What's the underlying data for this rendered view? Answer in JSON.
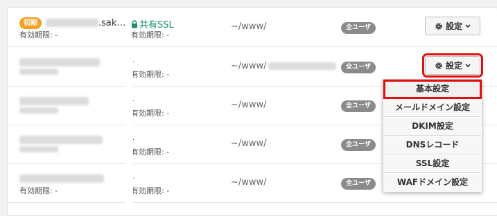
{
  "rows": [
    {
      "tag": "初期",
      "domain_suffix": ".sak…",
      "expiry": "有効期限: -",
      "ssl_label": "共有SSL",
      "ssl_expiry": "有効期限: -",
      "path": "~/www/",
      "badge": "全ユーザ",
      "settings_label": "設定"
    },
    {
      "ssl_top": "-",
      "ssl_expiry": "有効期限: -",
      "path": "~/www/",
      "badge": "全ユーザ",
      "settings_label": "設定"
    },
    {
      "ssl_top": "-",
      "ssl_expiry": "有効期限: -",
      "path": "~/www/",
      "badge": "全ユーザ"
    },
    {
      "ssl_top": "-",
      "ssl_expiry": "有効期限: -",
      "path": "~/www/",
      "badge": "全ユーザ"
    },
    {
      "expiry": "有効期限: -",
      "ssl_top": "-",
      "ssl_expiry": "有効期限: -",
      "path": "~/www/",
      "badge": "全ユーザ"
    }
  ],
  "dropdown": {
    "items": [
      "基本設定",
      "メールドメイン設定",
      "DKIM設定",
      "DNSレコード",
      "SSL設定",
      "WAFドメイン設定"
    ]
  },
  "colors": {
    "accent_orange": "#f5a024",
    "ssl_green": "#1a8f6e",
    "highlight_red": "#e01010"
  }
}
